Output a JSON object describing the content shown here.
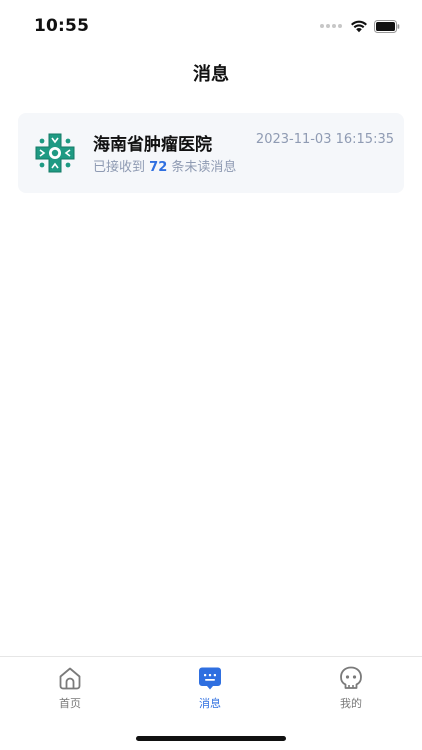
{
  "status_bar": {
    "time": "10:55"
  },
  "header": {
    "title": "消息"
  },
  "messages": [
    {
      "sender": "海南省肿瘤医院",
      "timestamp": "2023-11-03 16:15:35",
      "summary_prefix": "已接收到",
      "unread_count": "72",
      "summary_suffix": "条未读消息",
      "logo_icon": "hospital-logo-icon"
    }
  ],
  "tabs": [
    {
      "label": "首页",
      "icon": "home-icon",
      "active": false
    },
    {
      "label": "消息",
      "icon": "message-icon",
      "active": true
    },
    {
      "label": "我的",
      "icon": "profile-icon",
      "active": false
    }
  ],
  "colors": {
    "accent": "#2f6fe0",
    "logo_green": "#1f9a83",
    "muted_text": "#8f9bb3",
    "card_bg": "#f5f7fa"
  }
}
